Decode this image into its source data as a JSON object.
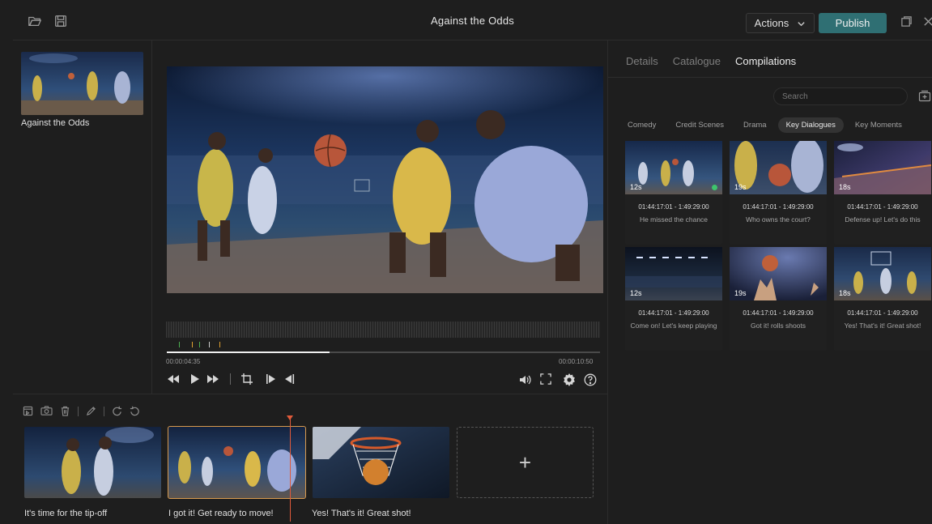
{
  "app": {
    "title": "Against the Odds"
  },
  "toolbar": {
    "actions_label": "Actions",
    "publish_label": "Publish",
    "icons": [
      "folder-open-icon",
      "save-icon",
      "maximize-icon",
      "close-icon"
    ]
  },
  "library": {
    "items": [
      {
        "label": "Against the Odds"
      }
    ]
  },
  "player": {
    "current_time": "00:00:04:35",
    "total_time": "00:00:10:50",
    "progress": 0.375,
    "icons": [
      "rewind-icon",
      "play-icon",
      "fast-forward-icon",
      "crop-icon",
      "mark-in-icon",
      "mark-out-icon",
      "volume-icon",
      "fullscreen-icon",
      "settings-icon",
      "help-icon"
    ]
  },
  "timeline": {
    "tools": [
      "add-media-icon",
      "snapshot-icon",
      "delete-icon",
      "pen-icon",
      "redo-icon",
      "undo-icon"
    ],
    "clips": [
      {
        "label": "It's time for the tip-off"
      },
      {
        "label": "I got it! Get ready to move!"
      },
      {
        "label": "Yes! That's it! Great shot!"
      }
    ],
    "add_label": "+"
  },
  "right_panel": {
    "tabs": [
      {
        "label": "Details"
      },
      {
        "label": "Catalogue"
      },
      {
        "label": "Compilations"
      }
    ],
    "active_tab": "Compilations",
    "search_placeholder": "Search",
    "categories": [
      {
        "label": "Comedy"
      },
      {
        "label": "Credit Scenes"
      },
      {
        "label": "Drama"
      },
      {
        "label": "Key Dialogues"
      },
      {
        "label": "Key Moments"
      }
    ],
    "active_category": "Key Dialogues",
    "cards": [
      {
        "duration": "12s",
        "timecode": "01:44:17:01 - 1:49:29:00",
        "caption": "He missed the chance",
        "status_color": "#3ec46d"
      },
      {
        "duration": "19s",
        "timecode": "01:44:17:01 - 1:49:29:00",
        "caption": "Who owns the court?"
      },
      {
        "duration": "18s",
        "timecode": "01:44:17:01 - 1:49:29:00",
        "caption": "Defense up! Let's do this"
      },
      {
        "duration": "12s",
        "timecode": "01:44:17:01 - 1:49:29:00",
        "caption": "Come on! Let's keep playing"
      },
      {
        "duration": "19s",
        "timecode": "01:44:17:01 - 1:49:29:00",
        "caption": "Got it! rolls shoots"
      },
      {
        "duration": "18s",
        "timecode": "01:44:17:01 - 1:49:29:00",
        "caption": "Yes! That's it! Great shot!"
      }
    ]
  }
}
